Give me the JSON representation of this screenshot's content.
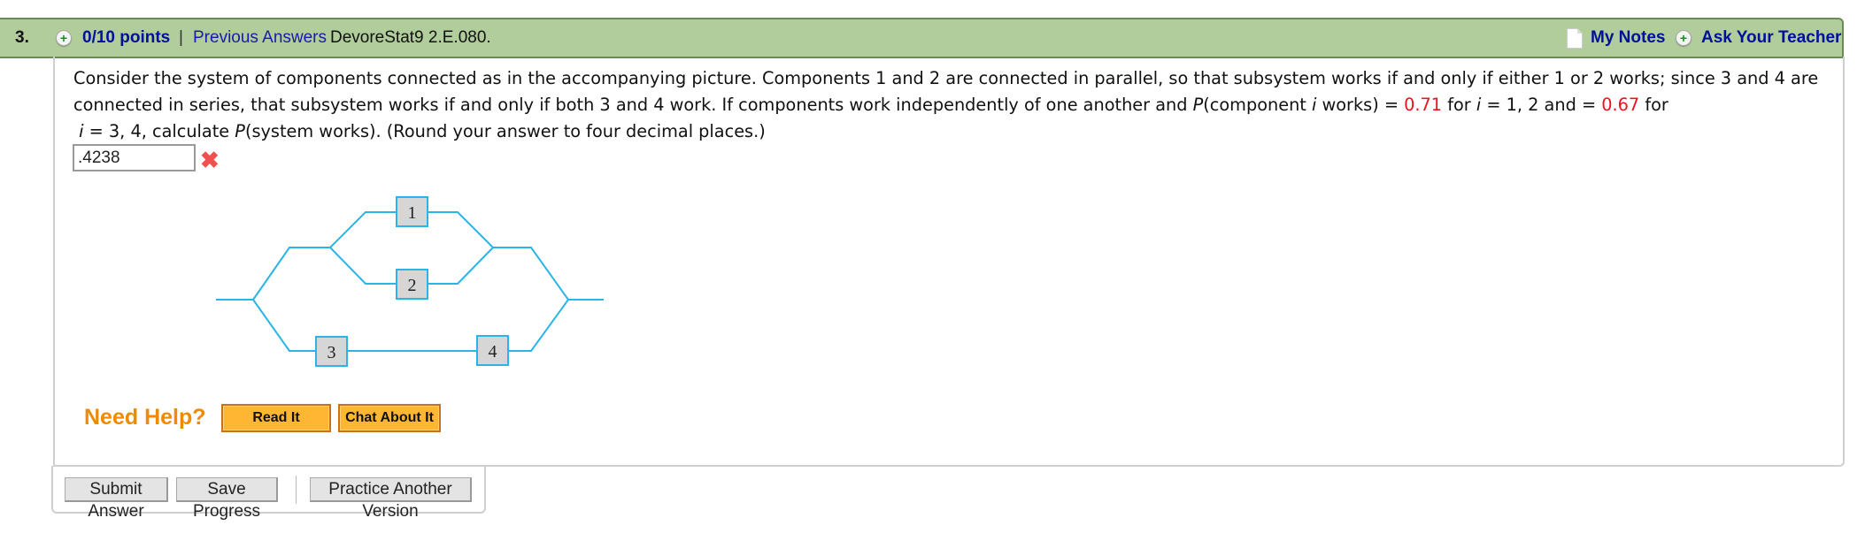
{
  "header": {
    "question_number": "3.",
    "points": "0/10 points",
    "separator": "|",
    "previous_answers": "Previous Answers",
    "problem_id": "DevoreStat9 2.E.080.",
    "my_notes": "My Notes",
    "ask_teacher": "Ask Your Teacher",
    "plus_glyph": "+"
  },
  "question": {
    "part1": "Consider the system of components connected as in the accompanying picture. Components 1 and 2 are connected in parallel, so that subsystem works if and only if either 1 or 2 works; since 3 and 4 are connected in series, that subsystem works if and only if both 3 and 4 work. If components work independently of one another and ",
    "p_italic": "P",
    "part2": "(component ",
    "i_italic": "i",
    "part3": " works) = ",
    "prob12": "0.71",
    "part4": " for  ",
    "part5": " = 1, 2  and = ",
    "prob34": "0.67",
    "part6": " for",
    "part7": " = 3, 4,  calculate ",
    "part8": "(system works). (Round your answer to four decimal places.)"
  },
  "answer": {
    "value": ".4238",
    "status_icon": "✖",
    "status": "incorrect"
  },
  "diagram": {
    "components": [
      "1",
      "2",
      "3",
      "4"
    ],
    "line_color": "#2ab4e8",
    "box_fill": "#d6d6d6"
  },
  "help": {
    "label": "Need Help?",
    "read_it": "Read It",
    "chat_about_it": "Chat About It"
  },
  "actions": {
    "submit": "Submit Answer",
    "save": "Save Progress",
    "practice": "Practice Another Version"
  }
}
